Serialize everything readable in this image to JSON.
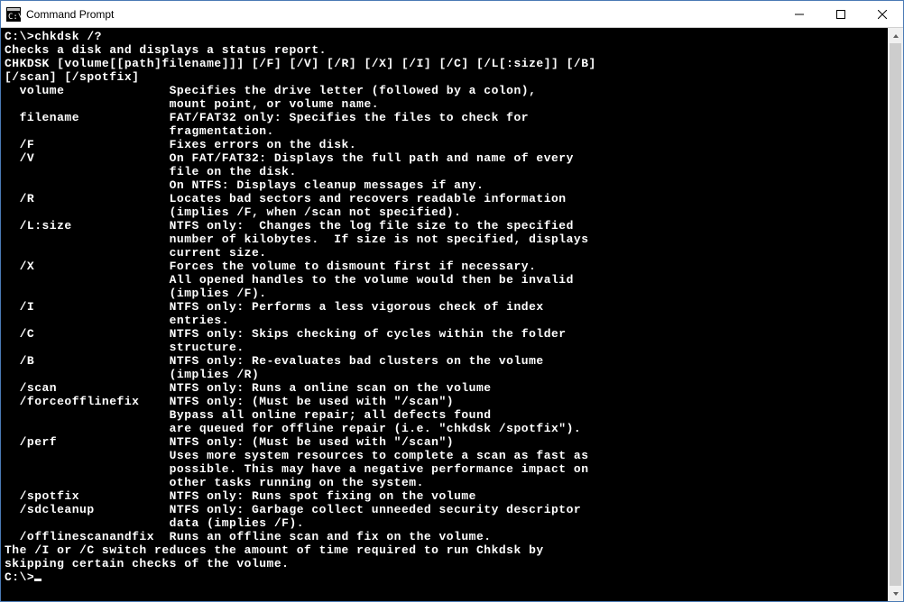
{
  "window": {
    "title": "Command Prompt"
  },
  "console": {
    "prompt1": "C:\\>",
    "command1": "chkdsk /?",
    "desc_line1": "Checks a disk and displays a status report.",
    "blank": "",
    "usage_line1": "CHKDSK [volume[[path]filename]]] [/F] [/V] [/R] [/X] [/I] [/C] [/L[:size]] [/B]",
    "usage_line2": "[/scan] [/spotfix]",
    "params": [
      {
        "name": "  volume",
        "desc": "Specifies the drive letter (followed by a colon),\n                      mount point, or volume name."
      },
      {
        "name": "  filename",
        "desc": "FAT/FAT32 only: Specifies the files to check for\n                      fragmentation."
      },
      {
        "name": "  /F",
        "desc": "Fixes errors on the disk."
      },
      {
        "name": "  /V",
        "desc": "On FAT/FAT32: Displays the full path and name of every\n                      file on the disk.\n                      On NTFS: Displays cleanup messages if any."
      },
      {
        "name": "  /R",
        "desc": "Locates bad sectors and recovers readable information\n                      (implies /F, when /scan not specified)."
      },
      {
        "name": "  /L:size",
        "desc": "NTFS only:  Changes the log file size to the specified\n                      number of kilobytes.  If size is not specified, displays\n                      current size."
      },
      {
        "name": "  /X",
        "desc": "Forces the volume to dismount first if necessary.\n                      All opened handles to the volume would then be invalid\n                      (implies /F)."
      },
      {
        "name": "  /I",
        "desc": "NTFS only: Performs a less vigorous check of index\n                      entries."
      },
      {
        "name": "  /C",
        "desc": "NTFS only: Skips checking of cycles within the folder\n                      structure."
      },
      {
        "name": "  /B",
        "desc": "NTFS only: Re-evaluates bad clusters on the volume\n                      (implies /R)"
      },
      {
        "name": "  /scan",
        "desc": "NTFS only: Runs a online scan on the volume"
      },
      {
        "name": "  /forceofflinefix",
        "desc": "NTFS only: (Must be used with \"/scan\")\n                      Bypass all online repair; all defects found\n                      are queued for offline repair (i.e. \"chkdsk /spotfix\")."
      },
      {
        "name": "  /perf",
        "desc": "NTFS only: (Must be used with \"/scan\")\n                      Uses more system resources to complete a scan as fast as\n                      possible. This may have a negative performance impact on\n                      other tasks running on the system."
      },
      {
        "name": "  /spotfix",
        "desc": "NTFS only: Runs spot fixing on the volume"
      },
      {
        "name": "  /sdcleanup",
        "desc": "NTFS only: Garbage collect unneeded security descriptor\n                      data (implies /F)."
      },
      {
        "name": "  /offlinescanandfix",
        "desc": "Runs an offline scan and fix on the volume."
      }
    ],
    "footer_line1": "The /I or /C switch reduces the amount of time required to run Chkdsk by",
    "footer_line2": "skipping certain checks of the volume.",
    "prompt2": "C:\\>"
  }
}
